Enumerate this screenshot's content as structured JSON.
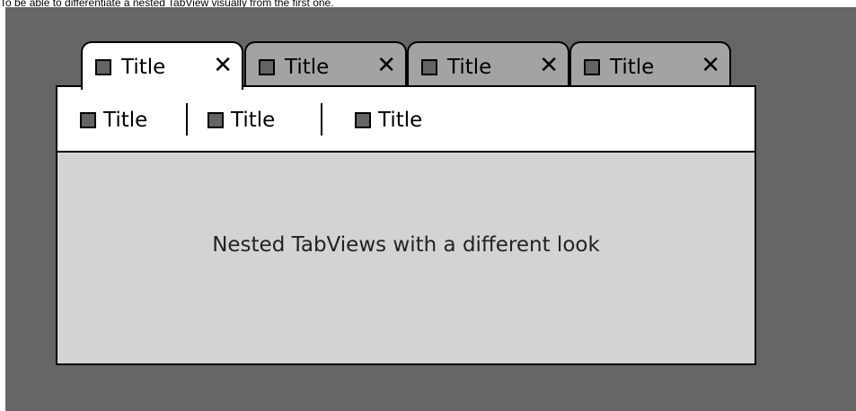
{
  "caption": "To be able to differentiate a nested TabView visually from the first one.",
  "outer_tabs": [
    {
      "label": "Title",
      "close": "✕",
      "active": true
    },
    {
      "label": "Title",
      "close": "✕",
      "active": false
    },
    {
      "label": "Title",
      "close": "✕",
      "active": false
    },
    {
      "label": "Title",
      "close": "✕",
      "active": false
    }
  ],
  "nested_tabs": [
    {
      "label": "Title"
    },
    {
      "label": "Title"
    },
    {
      "label": "Title"
    }
  ],
  "content": {
    "text": "Nested TabViews with a different look"
  },
  "colors": {
    "background": "#666666",
    "inactive_tab": "#a3a3a3",
    "active_tab": "#ffffff",
    "panel": "#d3d3d3",
    "icon_square": "#646464"
  }
}
